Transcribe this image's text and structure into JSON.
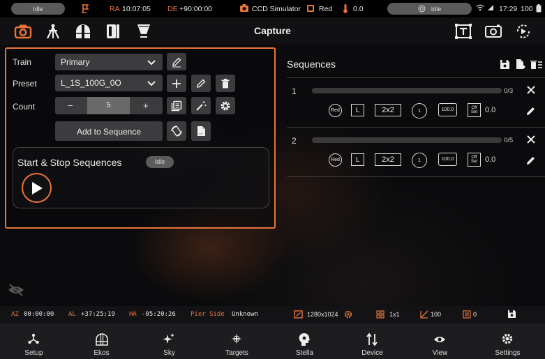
{
  "statusbar": {
    "left_pill": "Idle",
    "ra_label": "RA",
    "ra_value": "10:07:05",
    "de_label": "DE",
    "de_value": "+90:00:00",
    "camera": "CCD Simulator",
    "filter": "Red",
    "temperature": "0.0",
    "right_pill": "Idle",
    "time": "17:29",
    "battery": "100"
  },
  "toolbar": {
    "title": "Capture"
  },
  "capture": {
    "train_label": "Train",
    "train_value": "Primary",
    "preset_label": "Preset",
    "preset_value": "L_1S_100G_0O",
    "count_label": "Count",
    "count_value": "5",
    "count_minus": "−",
    "count_plus": "+",
    "add_to_sequence": "Add to Sequence",
    "start_stop_title": "Start & Stop Sequences",
    "state_badge": "Idle"
  },
  "sequences": {
    "title": "Sequences",
    "items": [
      {
        "index": "1",
        "progress": 0,
        "count": "0/3",
        "filter": "Red",
        "type": "L",
        "binning": "2x2",
        "exposure": "1",
        "gain": "100.0",
        "offset_label_1": "Off",
        "offset_label_2": "Set",
        "offset": "0.0"
      },
      {
        "index": "2",
        "progress": 0,
        "count": "0/5",
        "filter": "Red",
        "type": "L",
        "binning": "2x2",
        "exposure": "1",
        "gain": "100.0",
        "offset_label_1": "Off",
        "offset_label_2": "Set",
        "offset": "0.0"
      }
    ]
  },
  "infobar": {
    "az_label": "AZ",
    "az_value": "00:00:00",
    "al_label": "AL",
    "al_value": "+37:25:19",
    "ha_label": "HA",
    "ha_value": "-05:20:26",
    "pier_label": "Pier Side",
    "pier_value": "Unknown",
    "resolution": "1280x1024",
    "binning": "1x1",
    "gain": "100",
    "offset": "0"
  },
  "nav": [
    {
      "label": "Setup",
      "icon": "setup-icon"
    },
    {
      "label": "Ekos",
      "icon": "ekos-icon"
    },
    {
      "label": "Sky",
      "icon": "sky-icon"
    },
    {
      "label": "Targets",
      "icon": "targets-icon"
    },
    {
      "label": "Stella",
      "icon": "stella-icon"
    },
    {
      "label": "Device",
      "icon": "device-icon"
    },
    {
      "label": "View",
      "icon": "view-icon"
    },
    {
      "label": "Settings",
      "icon": "settings-icon"
    }
  ],
  "colors": {
    "accent": "#e8743b",
    "panel": "#3c3c3e",
    "background": "#0b0b0d"
  }
}
